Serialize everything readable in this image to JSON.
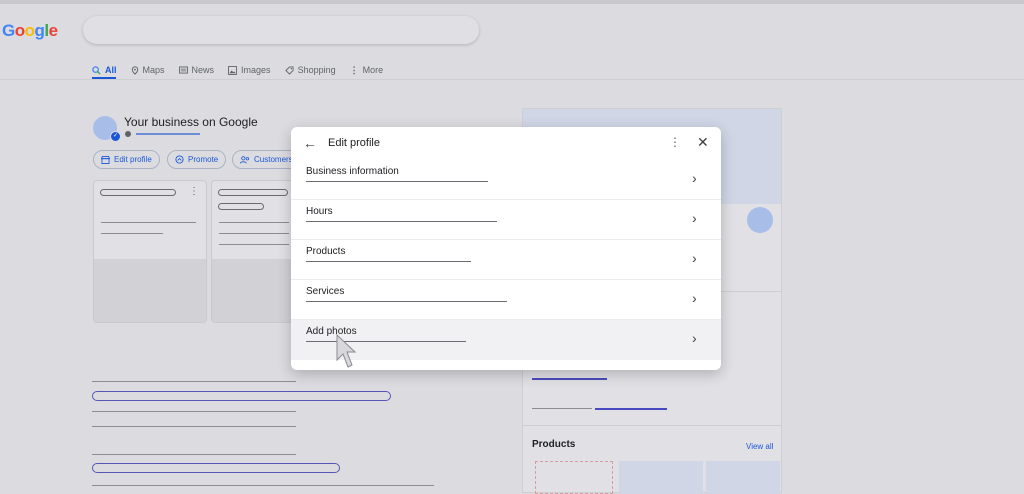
{
  "logo": "Google",
  "tabs": [
    {
      "label": "All",
      "icon": "search-icon",
      "active": true
    },
    {
      "label": "Maps",
      "icon": "map-pin-icon"
    },
    {
      "label": "News",
      "icon": "news-icon"
    },
    {
      "label": "Images",
      "icon": "image-icon"
    },
    {
      "label": "Shopping",
      "icon": "tag-icon"
    },
    {
      "label": "More",
      "icon": "more-vertical-icon"
    }
  ],
  "business": {
    "title": "Your business on Google",
    "chips": [
      "Edit profile",
      "Promote",
      "Customers"
    ]
  },
  "right_panel": {
    "products_label": "Products",
    "view_all_label": "View all"
  },
  "modal": {
    "title": "Edit profile",
    "rows": [
      {
        "label": "Business information"
      },
      {
        "label": "Hours"
      },
      {
        "label": "Products"
      },
      {
        "label": "Services"
      },
      {
        "label": "Add photos"
      }
    ]
  },
  "colors": {
    "accent": "#1a57d8",
    "background": "#dcdce0"
  }
}
